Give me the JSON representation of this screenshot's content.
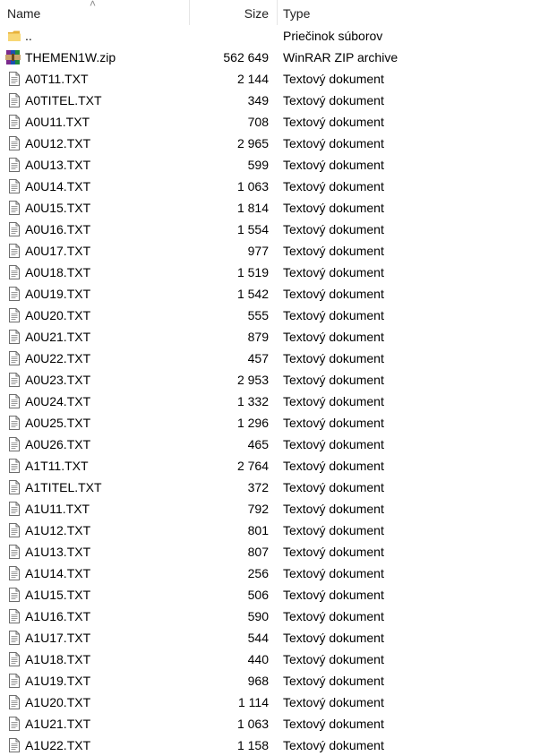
{
  "columns": {
    "name": "Name",
    "size": "Size",
    "type": "Type"
  },
  "sort": {
    "column": "name",
    "indicator": "chevron-up"
  },
  "files": [
    {
      "name": "..",
      "size": "",
      "type": "Priečinok súborov",
      "icon": "folder-icon"
    },
    {
      "name": "THEMEN1W.zip",
      "size": "562 649",
      "type": "WinRAR ZIP archive",
      "icon": "winrar-archive-icon"
    },
    {
      "name": "A0T11.TXT",
      "size": "2 144",
      "type": "Textový dokument",
      "icon": "text-file-icon"
    },
    {
      "name": "A0TITEL.TXT",
      "size": "349",
      "type": "Textový dokument",
      "icon": "text-file-icon"
    },
    {
      "name": "A0U11.TXT",
      "size": "708",
      "type": "Textový dokument",
      "icon": "text-file-icon"
    },
    {
      "name": "A0U12.TXT",
      "size": "2 965",
      "type": "Textový dokument",
      "icon": "text-file-icon"
    },
    {
      "name": "A0U13.TXT",
      "size": "599",
      "type": "Textový dokument",
      "icon": "text-file-icon"
    },
    {
      "name": "A0U14.TXT",
      "size": "1 063",
      "type": "Textový dokument",
      "icon": "text-file-icon"
    },
    {
      "name": "A0U15.TXT",
      "size": "1 814",
      "type": "Textový dokument",
      "icon": "text-file-icon"
    },
    {
      "name": "A0U16.TXT",
      "size": "1 554",
      "type": "Textový dokument",
      "icon": "text-file-icon"
    },
    {
      "name": "A0U17.TXT",
      "size": "977",
      "type": "Textový dokument",
      "icon": "text-file-icon"
    },
    {
      "name": "A0U18.TXT",
      "size": "1 519",
      "type": "Textový dokument",
      "icon": "text-file-icon"
    },
    {
      "name": "A0U19.TXT",
      "size": "1 542",
      "type": "Textový dokument",
      "icon": "text-file-icon"
    },
    {
      "name": "A0U20.TXT",
      "size": "555",
      "type": "Textový dokument",
      "icon": "text-file-icon"
    },
    {
      "name": "A0U21.TXT",
      "size": "879",
      "type": "Textový dokument",
      "icon": "text-file-icon"
    },
    {
      "name": "A0U22.TXT",
      "size": "457",
      "type": "Textový dokument",
      "icon": "text-file-icon"
    },
    {
      "name": "A0U23.TXT",
      "size": "2 953",
      "type": "Textový dokument",
      "icon": "text-file-icon"
    },
    {
      "name": "A0U24.TXT",
      "size": "1 332",
      "type": "Textový dokument",
      "icon": "text-file-icon"
    },
    {
      "name": "A0U25.TXT",
      "size": "1 296",
      "type": "Textový dokument",
      "icon": "text-file-icon"
    },
    {
      "name": "A0U26.TXT",
      "size": "465",
      "type": "Textový dokument",
      "icon": "text-file-icon"
    },
    {
      "name": "A1T11.TXT",
      "size": "2 764",
      "type": "Textový dokument",
      "icon": "text-file-icon"
    },
    {
      "name": "A1TITEL.TXT",
      "size": "372",
      "type": "Textový dokument",
      "icon": "text-file-icon"
    },
    {
      "name": "A1U11.TXT",
      "size": "792",
      "type": "Textový dokument",
      "icon": "text-file-icon"
    },
    {
      "name": "A1U12.TXT",
      "size": "801",
      "type": "Textový dokument",
      "icon": "text-file-icon"
    },
    {
      "name": "A1U13.TXT",
      "size": "807",
      "type": "Textový dokument",
      "icon": "text-file-icon"
    },
    {
      "name": "A1U14.TXT",
      "size": "256",
      "type": "Textový dokument",
      "icon": "text-file-icon"
    },
    {
      "name": "A1U15.TXT",
      "size": "506",
      "type": "Textový dokument",
      "icon": "text-file-icon"
    },
    {
      "name": "A1U16.TXT",
      "size": "590",
      "type": "Textový dokument",
      "icon": "text-file-icon"
    },
    {
      "name": "A1U17.TXT",
      "size": "544",
      "type": "Textový dokument",
      "icon": "text-file-icon"
    },
    {
      "name": "A1U18.TXT",
      "size": "440",
      "type": "Textový dokument",
      "icon": "text-file-icon"
    },
    {
      "name": "A1U19.TXT",
      "size": "968",
      "type": "Textový dokument",
      "icon": "text-file-icon"
    },
    {
      "name": "A1U20.TXT",
      "size": "1 114",
      "type": "Textový dokument",
      "icon": "text-file-icon"
    },
    {
      "name": "A1U21.TXT",
      "size": "1 063",
      "type": "Textový dokument",
      "icon": "text-file-icon"
    },
    {
      "name": "A1U22.TXT",
      "size": "1 158",
      "type": "Textový dokument",
      "icon": "text-file-icon"
    }
  ]
}
